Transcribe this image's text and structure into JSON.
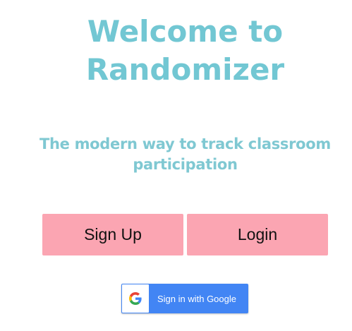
{
  "hero": {
    "title_line1": "Welcome to",
    "title_line2": "Randomizer",
    "subtitle": "The modern way to track classroom participation"
  },
  "actions": {
    "signup_label": "Sign Up",
    "login_label": "Login"
  },
  "google": {
    "label": "Sign in with Google",
    "icon": "google-g-icon"
  },
  "colors": {
    "title": "#72c7d3",
    "subtitle": "#7fc8d2",
    "button_bg": "#fba5b2",
    "google_blue": "#4285f4"
  }
}
